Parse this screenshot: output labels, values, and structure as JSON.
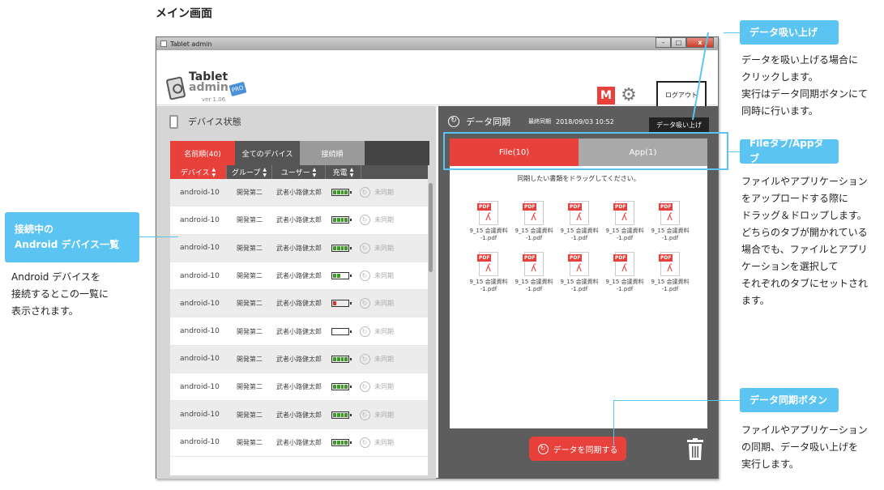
{
  "page_heading": "メイン画面",
  "window": {
    "title": "Tablet admin",
    "buttons": {
      "minimize": "–",
      "maximize": "□",
      "close": "x"
    }
  },
  "header": {
    "logo_title": "Tablet",
    "logo_sub": "admin",
    "logo_pro": "PRO",
    "logo_version": "ver 1.06",
    "m_badge": "M",
    "logout_label": "ログアウト"
  },
  "left": {
    "title": "デバイス状態",
    "filters": [
      "名前順(40)",
      "全てのデバイス",
      "接続順"
    ],
    "columns": [
      "デバイス",
      "グループ",
      "ユーザー",
      "充電"
    ],
    "rows": [
      {
        "device": "android-10",
        "group": "開発第二",
        "user": "武者小路健太郎",
        "battery": 1.0,
        "status": "未同期"
      },
      {
        "device": "android-10",
        "group": "開発第二",
        "user": "武者小路健太郎",
        "battery": 1.0,
        "status": "未同期"
      },
      {
        "device": "android-10",
        "group": "開発第二",
        "user": "武者小路健太郎",
        "battery": 1.0,
        "status": "未同期"
      },
      {
        "device": "android-10",
        "group": "開発第二",
        "user": "武者小路健太郎",
        "battery": 0.5,
        "status": "未同期"
      },
      {
        "device": "android-10",
        "group": "開発第二",
        "user": "武者小路健太郎",
        "battery": 0.25,
        "status": "未同期"
      },
      {
        "device": "android-10",
        "group": "開発第二",
        "user": "武者小路健太郎",
        "battery": 0.0,
        "status": "未同期"
      },
      {
        "device": "android-10",
        "group": "開発第二",
        "user": "武者小路健太郎",
        "battery": 1.0,
        "status": "未同期"
      },
      {
        "device": "android-10",
        "group": "開発第二",
        "user": "武者小路健太郎",
        "battery": 1.0,
        "status": "未同期"
      },
      {
        "device": "android-10",
        "group": "開発第二",
        "user": "武者小路健太郎",
        "battery": 1.0,
        "status": "未同期"
      },
      {
        "device": "android-10",
        "group": "開発第二",
        "user": "武者小路健太郎",
        "battery": 1.0,
        "status": "未同期"
      }
    ]
  },
  "right": {
    "title": "データ同期",
    "last_sync_label": "最終同期",
    "last_sync_value": "2018/09/03 10:52",
    "pull_button": "データ吸い上げ",
    "tabs": [
      "File(10)",
      "App(1)"
    ],
    "drop_hint": "同期したい書類をドラッグしてください。",
    "file_tag": "PDF",
    "files": [
      "9_15 会議資料\n-1.pdf",
      "9_15 会議資料\n-1.pdf",
      "9_15 会議資料\n-1.pdf",
      "9_15 会議資料\n-1.pdf",
      "9_15 会議資料\n-1.pdf",
      "9_15 会議資料\n-1.pdf",
      "9_15 会議資料\n-1.pdf",
      "9_15 会議資料\n-1.pdf",
      "9_15 会議資料\n-1.pdf",
      "9_15 会議資料\n-1.pdf"
    ],
    "sync_button": "データを同期する"
  },
  "callouts": {
    "android_list": {
      "title": "接続中の\nAndroid デバイス一覧",
      "desc": "Android デバイスを\n接続するとこの一覧に\n表示されます。"
    },
    "pull": {
      "title": "データ吸い上げ",
      "desc": "データを吸い上げる場合に\nクリックします。\n実行はデータ同期ボタンにて\n同時に行います。"
    },
    "tabs": {
      "title": "Fileタブ/Appタブ",
      "desc": "ファイルやアプリケーション\nをアップロードする際に\nドラッグ＆ドロップします。\nどちらのタブが開かれている\n場合でも、ファイルとアプリ\nケーションを選択して\nそれぞれのタブにセットされ\nます。"
    },
    "sync_button": {
      "title": "データ同期ボタン",
      "desc": "ファイルやアプリケーション\nの同期、データ吸い上げを\n実行します。"
    }
  },
  "colors": {
    "accent": "#e8413b",
    "callout": "#5bc4f2",
    "battery_full": "#3e9a2b",
    "battery_low": "#d93030"
  }
}
